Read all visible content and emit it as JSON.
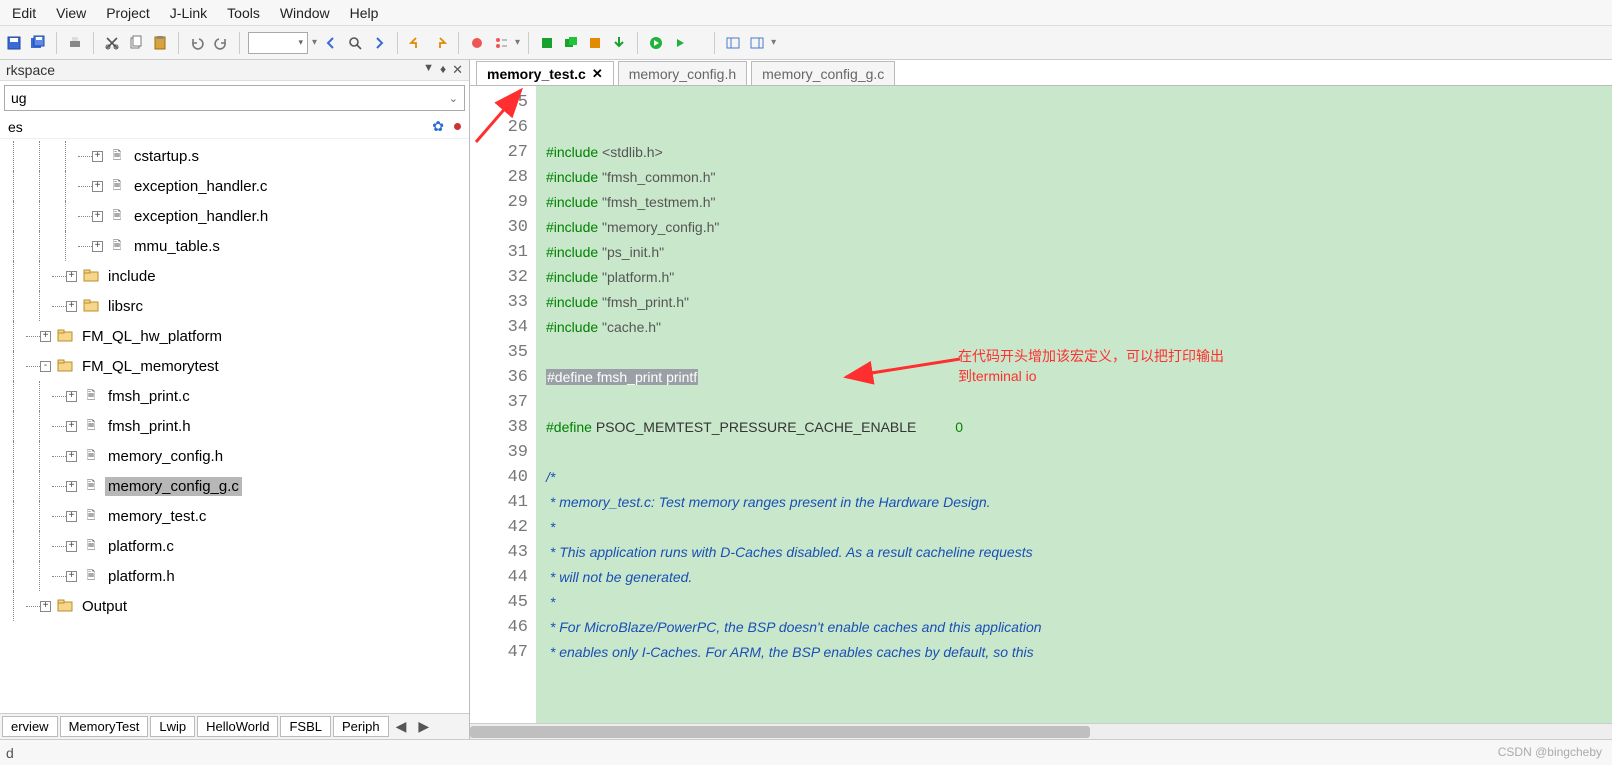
{
  "menu": {
    "items": [
      "Edit",
      "View",
      "Project",
      "J-Link",
      "Tools",
      "Window",
      "Help"
    ]
  },
  "workspace": {
    "title": "rkspace",
    "config_selected": "ug",
    "files_label": "es"
  },
  "tree": [
    {
      "depth": 3,
      "exp": "+",
      "kind": "file",
      "label": "cstartup.s"
    },
    {
      "depth": 3,
      "exp": "+",
      "kind": "file",
      "label": "exception_handler.c"
    },
    {
      "depth": 3,
      "exp": "+",
      "kind": "file",
      "label": "exception_handler.h"
    },
    {
      "depth": 3,
      "exp": "+",
      "kind": "file",
      "label": "mmu_table.s"
    },
    {
      "depth": 2,
      "exp": "+",
      "kind": "folder",
      "label": "include"
    },
    {
      "depth": 2,
      "exp": "+",
      "kind": "folder",
      "label": "libsrc"
    },
    {
      "depth": 1,
      "exp": "+",
      "kind": "folder",
      "label": "FM_QL_hw_platform"
    },
    {
      "depth": 1,
      "exp": "-",
      "kind": "folder",
      "label": "FM_QL_memorytest"
    },
    {
      "depth": 2,
      "exp": "+",
      "kind": "file",
      "label": "fmsh_print.c"
    },
    {
      "depth": 2,
      "exp": "+",
      "kind": "file",
      "label": "fmsh_print.h"
    },
    {
      "depth": 2,
      "exp": "+",
      "kind": "file",
      "label": "memory_config.h"
    },
    {
      "depth": 2,
      "exp": "+",
      "kind": "file",
      "label": "memory_config_g.c",
      "selected": true
    },
    {
      "depth": 2,
      "exp": "+",
      "kind": "file",
      "label": "memory_test.c"
    },
    {
      "depth": 2,
      "exp": "+",
      "kind": "file",
      "label": "platform.c"
    },
    {
      "depth": 2,
      "exp": "+",
      "kind": "file",
      "label": "platform.h"
    },
    {
      "depth": 1,
      "exp": "+",
      "kind": "folder",
      "label": "Output"
    }
  ],
  "ws_bottom_tabs": [
    "erview",
    "MemoryTest",
    "Lwip",
    "HelloWorld",
    "FSBL",
    "Periph"
  ],
  "editor_tabs": [
    {
      "label": "memory_test.c",
      "active": true,
      "closable": true
    },
    {
      "label": "memory_config.h",
      "active": false
    },
    {
      "label": "memory_config_g.c",
      "active": false
    }
  ],
  "first_line_no": 25,
  "code_lines": [
    {
      "type": "blank"
    },
    {
      "type": "blank"
    },
    {
      "type": "inc",
      "keyword": "#include",
      "arg": "<stdlib.h>"
    },
    {
      "type": "inc",
      "keyword": "#include",
      "arg": "\"fmsh_common.h\""
    },
    {
      "type": "inc",
      "keyword": "#include",
      "arg": "\"fmsh_testmem.h\""
    },
    {
      "type": "inc",
      "keyword": "#include",
      "arg": "\"memory_config.h\""
    },
    {
      "type": "inc",
      "keyword": "#include",
      "arg": "\"ps_init.h\""
    },
    {
      "type": "inc",
      "keyword": "#include",
      "arg": "\"platform.h\""
    },
    {
      "type": "inc",
      "keyword": "#include",
      "arg": "\"fmsh_print.h\""
    },
    {
      "type": "inc",
      "keyword": "#include",
      "arg": "\"cache.h\""
    },
    {
      "type": "blank"
    },
    {
      "type": "selected_define",
      "text": "#define fmsh_print printf"
    },
    {
      "type": "blank"
    },
    {
      "type": "define",
      "keyword": "#define",
      "name": "PSOC_MEMTEST_PRESSURE_CACHE_ENABLE",
      "value": "0"
    },
    {
      "type": "blank"
    },
    {
      "type": "cmt",
      "text": "/*",
      "fold": true
    },
    {
      "type": "cmt",
      "text": " * memory_test.c: Test memory ranges present in the Hardware Design."
    },
    {
      "type": "cmt",
      "text": " *"
    },
    {
      "type": "cmt",
      "text": " * This application runs with D-Caches disabled. As a result cacheline requests"
    },
    {
      "type": "cmt",
      "text": " * will not be generated."
    },
    {
      "type": "cmt",
      "text": " *"
    },
    {
      "type": "cmt",
      "text": " * For MicroBlaze/PowerPC, the BSP doesn't enable caches and this application"
    },
    {
      "type": "cmt",
      "text": " * enables only I-Caches. For ARM, the BSP enables caches by default, so this"
    }
  ],
  "annotation": {
    "line1": "在代码开头增加该宏定义，可以把打印输出",
    "line2": "到terminal io"
  },
  "status_left": "d",
  "watermark": "CSDN @bingcheby",
  "colors": {
    "accent": "#0a8f00",
    "code_bg": "#c9e8cb",
    "red": "#ff2e2f",
    "select": "#b7b7b7"
  }
}
